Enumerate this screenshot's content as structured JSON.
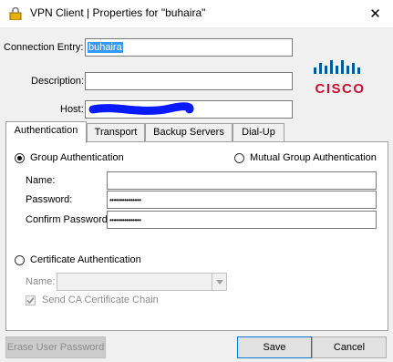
{
  "window": {
    "title": "VPN Client  |  Properties for \"buhaira\"",
    "close_glyph": "✕"
  },
  "form": {
    "connection_entry_label": "Connection Entry:",
    "connection_entry_value": "buhaira",
    "description_label": "Description:",
    "description_value": "",
    "host_label": "Host:"
  },
  "brand": {
    "logo_text": "CISCO",
    "color": "#c8102e",
    "bars_color": "#005b9a"
  },
  "tabs": [
    {
      "label": "Authentication",
      "active": true
    },
    {
      "label": "Transport",
      "active": false
    },
    {
      "label": "Backup Servers",
      "active": false
    },
    {
      "label": "Dial-Up",
      "active": false
    }
  ],
  "auth": {
    "group_auth_label": "Group Authentication",
    "mutual_auth_label": "Mutual Group Authentication",
    "name_label": "Name:",
    "name_value": "",
    "password_label": "Password:",
    "password_value": "•••••••••••••••",
    "confirm_password_label": "Confirm Password:",
    "confirm_password_value": "•••••••••••••••",
    "cert_auth_label": "Certificate Authentication",
    "cert_name_label": "Name:",
    "send_ca_label": "Send CA Certificate Chain"
  },
  "buttons": {
    "erase_password": "Erase User Password",
    "save": "Save",
    "cancel": "Cancel"
  }
}
